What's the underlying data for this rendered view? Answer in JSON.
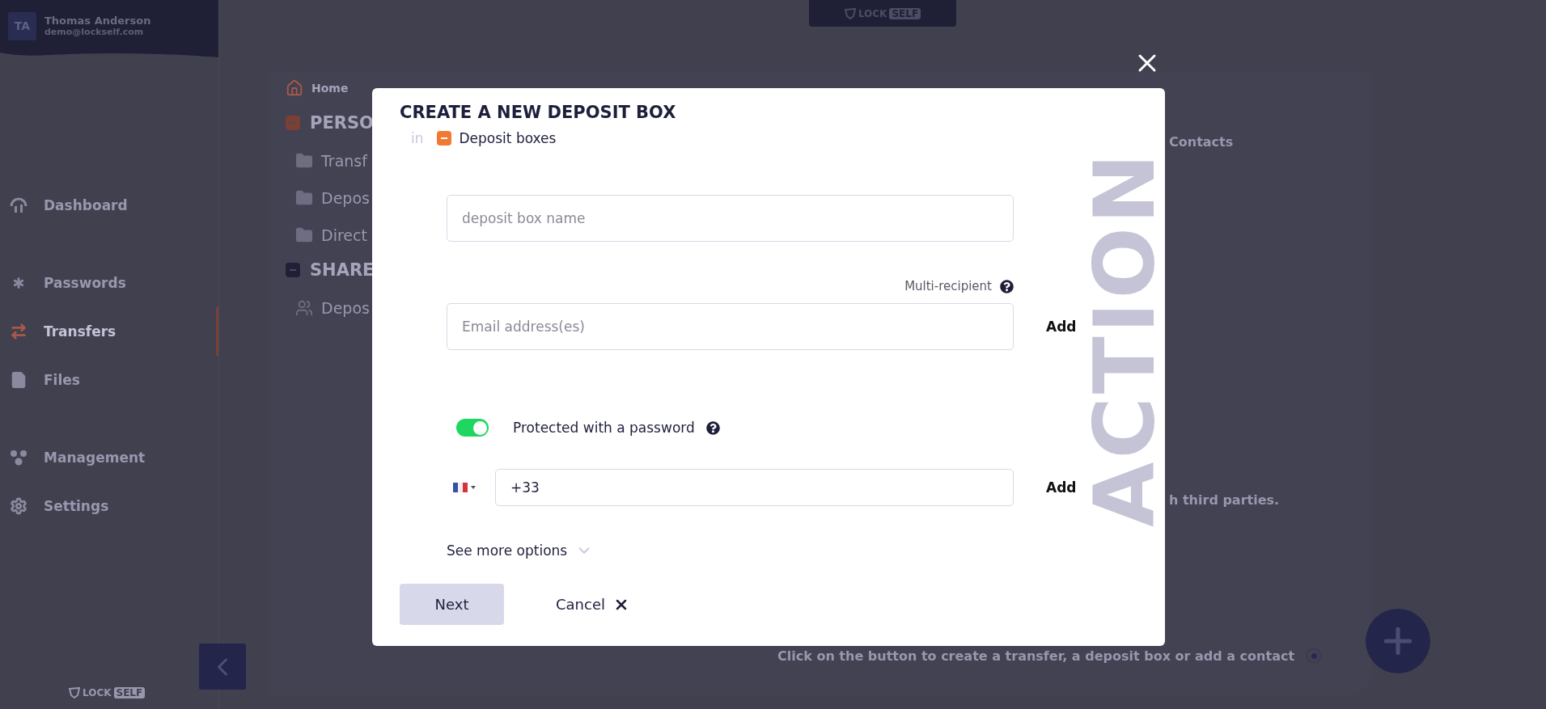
{
  "user": {
    "initials": "TA",
    "name": "Thomas Anderson",
    "email": "demo@lockself.com"
  },
  "top_logo": {
    "word": "LOCK",
    "badge": "SELF"
  },
  "nav_groups": [
    [
      {
        "label": "Dashboard",
        "kind": "dashboard",
        "selected": false
      }
    ],
    [
      {
        "label": "Passwords",
        "kind": "passwords",
        "selected": false
      },
      {
        "label": "Transfers",
        "kind": "transfers",
        "selected": true
      },
      {
        "label": "Files",
        "kind": "files",
        "selected": false
      }
    ],
    [
      {
        "label": "Management",
        "kind": "management",
        "selected": false
      },
      {
        "label": "Settings",
        "kind": "settings",
        "selected": false
      }
    ]
  ],
  "sidebar_logo": {
    "word": "LOCK",
    "badge": "SELF"
  },
  "breadcrumb": "Home",
  "tree": [
    {
      "label": "PERSO",
      "color": "#7a3f35",
      "children": [
        {
          "label": "Transf",
          "kind": "folder"
        },
        {
          "label": "Depos",
          "kind": "folder"
        },
        {
          "label": "Direct",
          "kind": "folder"
        }
      ]
    },
    {
      "label": "SHARE",
      "color": "#1f2038",
      "children": [
        {
          "label": "Depos",
          "kind": "shared"
        }
      ]
    }
  ],
  "background_texts": {
    "contacts": "Contacts",
    "third_parties": "h third parties.",
    "hint": "Click on the button to create a transfer, a deposit box or add a contact"
  },
  "modal": {
    "title": "CREATE A NEW DEPOSIT BOX",
    "location_prefix": "in",
    "location": "Deposit boxes",
    "side_text": "ACTION",
    "name_field": {
      "placeholder": "deposit box name"
    },
    "multi_recipient": "Multi-recipient",
    "email_field": {
      "placeholder": "Email address(es)"
    },
    "email_add": "Add",
    "password_protection": {
      "label": "Protected with a password",
      "on": true
    },
    "phone_field": {
      "value": "+33"
    },
    "phone_add": "Add",
    "more_options": "See more options",
    "next": "Next",
    "cancel": "Cancel"
  }
}
